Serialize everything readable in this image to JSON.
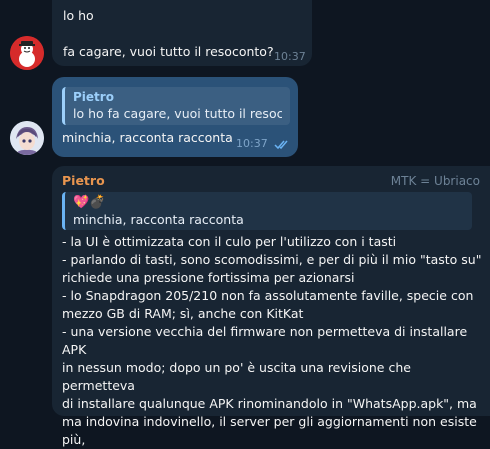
{
  "messages": [
    {
      "id": "msg1",
      "text_line1": "lo ho",
      "text_line2": "fa cagare, vuoi tutto il resoconto?",
      "time": "10:37"
    },
    {
      "id": "msg2",
      "reply_author": "Pietro",
      "reply_text": "lo ho  fa cagare, vuoi tutto il resoc...",
      "text": "minchia, racconta racconta",
      "time": "10:37",
      "read_status": "✓✓"
    },
    {
      "id": "msg3",
      "sender": "Pietro",
      "sender_tag": "MTK = Ubriaco",
      "reply_emoji": "💖💣",
      "reply_text": "minchia, racconta racconta",
      "lines": [
        "- la UI è ottimizzata con il culo per l'utilizzo con i tasti",
        "- parlando di tasti, sono scomodissimi, e per di più il mio \"tasto su\"",
        "richiede una pressione fortissima per azionarsi",
        "- lo Snapdragon 205/210 non fa assolutamente faville, specie con",
        "mezzo GB di RAM; sì, anche con KitKat",
        "- una versione vecchia del firmware non permetteva di installare APK",
        "in nessun modo; dopo un po' è uscita una revisione che permetteva",
        "di installare qualunque APK rinominandolo in \"WhatsApp.apk\", ma",
        "ma indovina indovinello, il server per gli aggiornamenti non esiste più,"
      ]
    }
  ],
  "colors": {
    "background": "#0e1621",
    "bubble_in": "#182533",
    "bubble_out": "#2b5278",
    "sender_name": "#e8954f",
    "reply_accent": "#6ab3f3"
  }
}
